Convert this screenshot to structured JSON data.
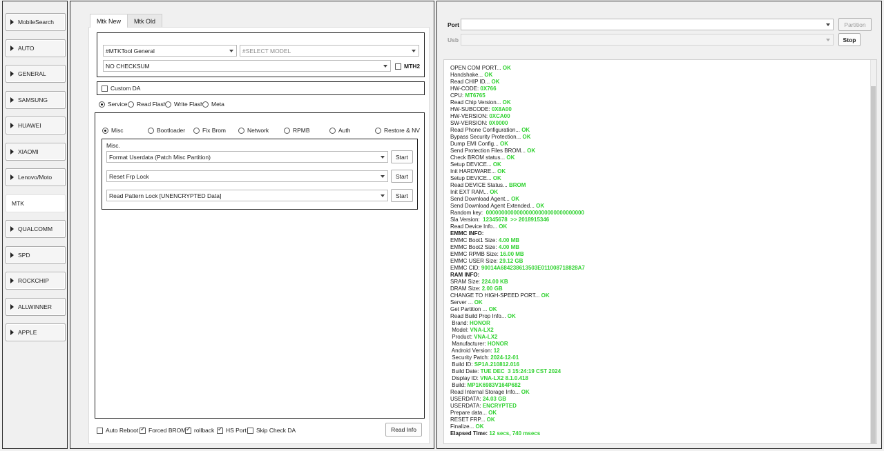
{
  "sidebar": {
    "items": [
      {
        "label": "MobileSearch",
        "active": false
      },
      {
        "label": "AUTO",
        "active": false
      },
      {
        "label": "GENERAL",
        "active": false
      },
      {
        "label": "SAMSUNG",
        "active": false
      },
      {
        "label": "HUAWEI",
        "active": false
      },
      {
        "label": "XIAOMI",
        "active": false
      },
      {
        "label": "Lenovo/Moto",
        "active": false
      },
      {
        "label": "MTK",
        "active": true
      },
      {
        "label": "QUALCOMM",
        "active": false
      },
      {
        "label": "SPD",
        "active": false
      },
      {
        "label": "ROCKCHIP",
        "active": false
      },
      {
        "label": "ALLWINNER",
        "active": false
      },
      {
        "label": "APPLE",
        "active": false
      }
    ]
  },
  "tabs": [
    {
      "label": "Mtk New",
      "active": true
    },
    {
      "label": "Mtk Old",
      "active": false
    }
  ],
  "config": {
    "tool_select": "#MTKTool General",
    "model_select_placeholder": "#SELECT MODEL",
    "checksum_select": "NO CHECKSUM",
    "mth2_label": "MTH2",
    "custom_da_label": "Custom DA"
  },
  "modes": {
    "service": "Service",
    "read_flash": "Read Flash",
    "write_flash": "Write Flash",
    "meta": "Meta"
  },
  "ops": {
    "misc": "Misc",
    "bootloader": "Bootloader",
    "fix_brom": "Fix Brom",
    "network": "Network",
    "rpmb": "RPMB",
    "auth": "Auth",
    "restore_nv": "Restore & NV"
  },
  "misc_group": {
    "title": "Misc.",
    "rows": [
      {
        "value": "Format Userdata (Patch Misc Partition)",
        "button": "Start"
      },
      {
        "value": "Reset Frp Lock",
        "button": "Start"
      },
      {
        "value": "Read Pattern Lock [UNENCRYPTED Data]",
        "button": "Start"
      }
    ]
  },
  "footer": {
    "auto_reboot": "Auto Reboot",
    "forced_brom": "Forced BROM",
    "rollback": "rollback",
    "hs_port": "HS Port",
    "skip_check_da": "Skip Check DA",
    "read_info": "Read Info"
  },
  "port": {
    "port_label": "Port",
    "usb_label": "Usb",
    "partition_button": "Partition",
    "stop_button": "Stop"
  },
  "log": [
    {
      "t": "OPEN COM PORT... ",
      "v": "OK"
    },
    {
      "t": "Handshake... ",
      "v": "OK"
    },
    {
      "t": "Read CHIP ID... ",
      "v": "OK"
    },
    {
      "t": "HW-CODE: ",
      "v": "0X766"
    },
    {
      "t": "CPU: ",
      "v": "MT6765"
    },
    {
      "t": "Read Chip Version... ",
      "v": "OK"
    },
    {
      "t": "HW-SUBCODE: ",
      "v": "0X8A00"
    },
    {
      "t": "HW-VERSION: ",
      "v": "0XCA00"
    },
    {
      "t": "SW-VERSION: ",
      "v": "0X0000"
    },
    {
      "t": "Read Phone Configuration... ",
      "v": "OK"
    },
    {
      "t": "Bypass Security Protection... ",
      "v": "OK"
    },
    {
      "t": "Dump EMI Config... ",
      "v": "OK"
    },
    {
      "t": "Send Protection Files BROM... ",
      "v": "OK"
    },
    {
      "t": "Check BROM status... ",
      "v": "OK"
    },
    {
      "t": "Setup DEVICE... ",
      "v": "OK"
    },
    {
      "t": "Init HARDWARE... ",
      "v": "OK"
    },
    {
      "t": "Setup DEVICE... ",
      "v": "OK"
    },
    {
      "t": "Read DEVICE Status... ",
      "v": "BROM"
    },
    {
      "t": "Init EXT RAM... ",
      "v": "OK"
    },
    {
      "t": "Send Download Agent... ",
      "v": "OK"
    },
    {
      "t": "Send Download Agent Extended... ",
      "v": "OK"
    },
    {
      "t": "Random key:  ",
      "v": "00000000000000000000000000000000"
    },
    {
      "t": "Sla Version:  ",
      "v": "12345678  >> 2018915346"
    },
    {
      "t": "Read Device Info... ",
      "v": "OK"
    },
    {
      "t": "EMMC INFO:",
      "v": "",
      "h": true
    },
    {
      "t": "EMMC Boot1 Size: ",
      "v": "4.00 MB"
    },
    {
      "t": "EMMC Boot2 Size: ",
      "v": "4.00 MB"
    },
    {
      "t": "EMMC RPMB Size: ",
      "v": "16.00 MB"
    },
    {
      "t": "EMMC USER Size: ",
      "v": "29.12 GB"
    },
    {
      "t": "EMMC CID: ",
      "v": "90014A684238613503E011008718828A7"
    },
    {
      "t": "RAM INFO:",
      "v": "",
      "h": true
    },
    {
      "t": "SRAM Size: ",
      "v": "224.00 KB"
    },
    {
      "t": "DRAM Size: ",
      "v": "2.00 GB"
    },
    {
      "t": "CHANGE TO HIGH-SPEED PORT... ",
      "v": "OK"
    },
    {
      "t": "Server ... ",
      "v": "OK"
    },
    {
      "t": "Get Partition ... ",
      "v": "OK"
    },
    {
      "t": "Read Build Prop Info... ",
      "v": "OK"
    },
    {
      "t": " Brand: ",
      "v": "HONOR"
    },
    {
      "t": " Model: ",
      "v": "VNA-LX2"
    },
    {
      "t": " Product: ",
      "v": "VNA-LX2"
    },
    {
      "t": " Manufacturer: ",
      "v": "HONOR"
    },
    {
      "t": " Android Version: ",
      "v": "12"
    },
    {
      "t": " Security Patch: ",
      "v": "2024-12-01"
    },
    {
      "t": " Build ID: ",
      "v": "SP1A.210812.016"
    },
    {
      "t": " Build Date: ",
      "v": "TUE DEC  3 15:24:19 CST 2024"
    },
    {
      "t": " Display ID: ",
      "v": "VNA-LX2 8.1.0.418"
    },
    {
      "t": " Build: ",
      "v": "MP1K6983V164P682"
    },
    {
      "t": "Read Internal Storage Info... ",
      "v": "OK"
    },
    {
      "t": "USERDATA: ",
      "v": "24.03 GB"
    },
    {
      "t": "USERDATA: ",
      "v": "ENCRYPTED"
    },
    {
      "t": "Prepare data... ",
      "v": "OK"
    },
    {
      "t": "RESET FRP... ",
      "v": "OK"
    },
    {
      "t": "Finalize... ",
      "v": "OK"
    },
    {
      "t": "Elapsed Time: ",
      "v": "12 secs, 740 msecs",
      "h": true
    }
  ]
}
